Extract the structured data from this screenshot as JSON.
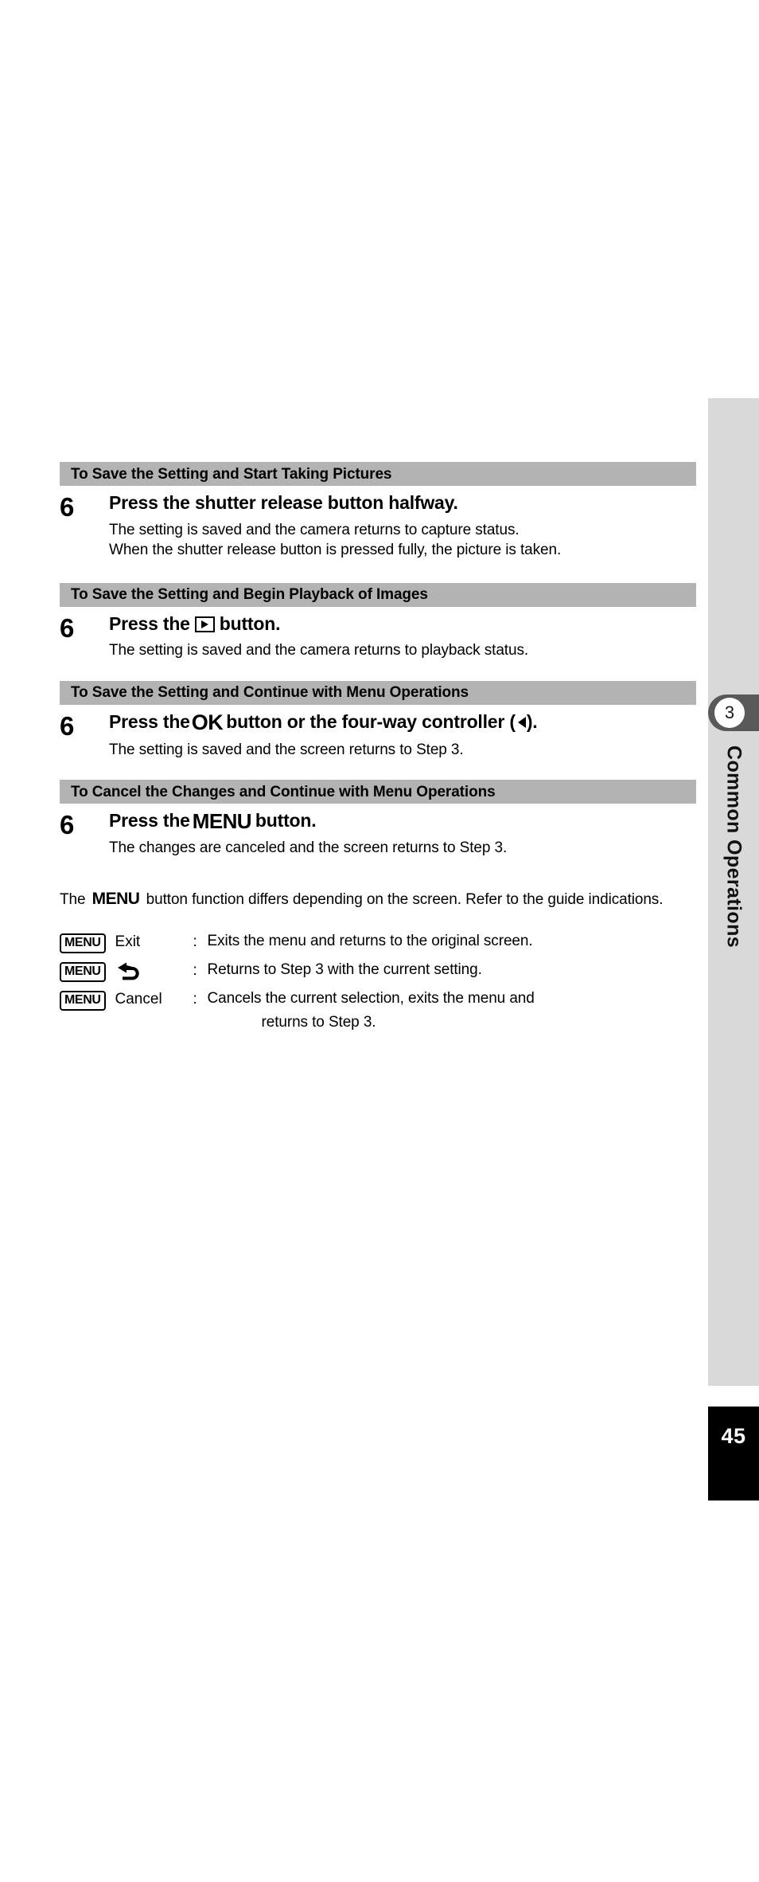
{
  "page": {
    "number": "45",
    "chapter_number": "3",
    "chapter_title": "Common Operations"
  },
  "sections": [
    {
      "heading": "To Save the Setting and Start Taking Pictures",
      "step_number": "6",
      "title_prefix": "Press the shutter release button halfway.",
      "desc_line1": "The setting is saved and the camera returns to capture status.",
      "desc_line2": "When the shutter release button is pressed fully, the picture is taken."
    },
    {
      "heading": "To Save the Setting and Begin Playback of Images",
      "step_number": "6",
      "title_prefix": "Press the",
      "title_suffix": "button.",
      "icon": "playback-icon",
      "desc_line1": "The setting is saved and the camera returns to playback status."
    },
    {
      "heading": "To Save the Setting and Continue with Menu Operations",
      "step_number": "6",
      "title_prefix": "Press the",
      "title_ok": "OK",
      "title_middle": "button or the four-way controller (",
      "title_suffix": ").",
      "icon": "left-arrow-icon",
      "desc_line1": "The setting is saved and the screen returns to Step 3."
    },
    {
      "heading": "To Cancel the Changes and Continue with Menu Operations",
      "step_number": "6",
      "title_prefix": "Press the",
      "title_menu": "MENU",
      "title_suffix": "button.",
      "desc_line1": "The changes are canceled and the screen returns to Step 3."
    }
  ],
  "note": {
    "part1": "The",
    "menu_word": "MENU",
    "part2": "button function differs depending on the screen. Refer to the guide indications."
  },
  "guide_rows": [
    {
      "chip": "MENU",
      "action": "Exit",
      "colon": ":",
      "text": "Exits the menu and returns to the original screen."
    },
    {
      "chip": "MENU",
      "action_icon": "return-arrow-icon",
      "action": "",
      "colon": ":",
      "text": "Returns to Step 3 with the current setting."
    },
    {
      "chip": "MENU",
      "action": "Cancel",
      "colon": ":",
      "text": "Cancels the current selection, exits the menu and",
      "text_line2": "returns to Step 3."
    }
  ],
  "colors": {
    "section_bar": "#b3b3b3",
    "side_rail": "#d9d9d9",
    "side_tab": "#595959",
    "page_block": "#000000"
  }
}
